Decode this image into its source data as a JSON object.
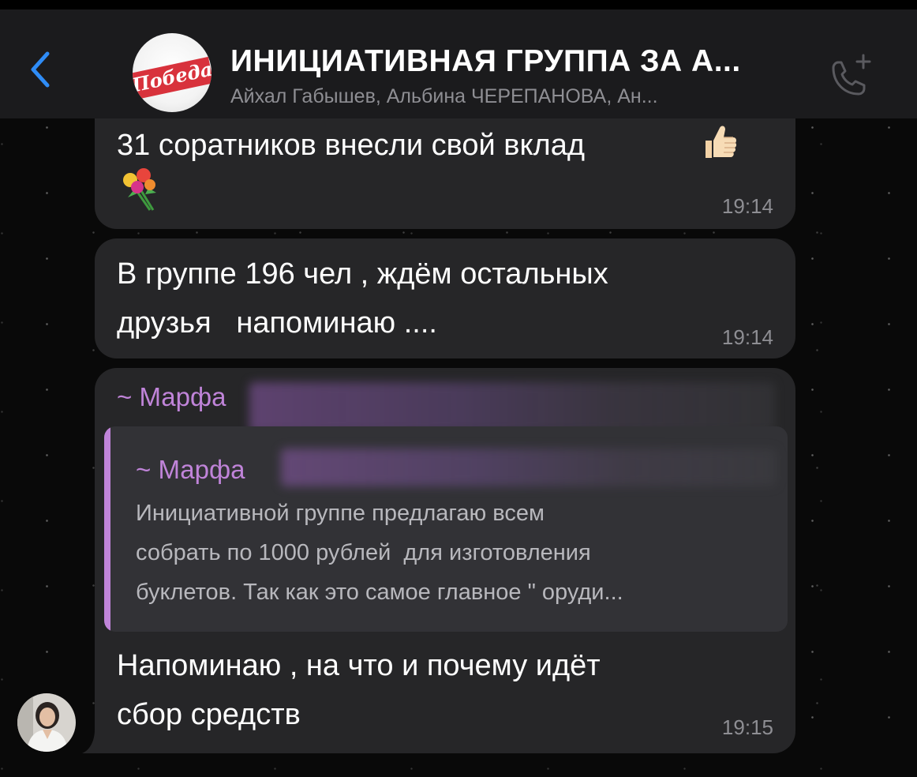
{
  "header": {
    "title": "ИНИЦИАТИВНАЯ ГРУППА ЗА А...",
    "subtitle": "Айхал Габышев, Альбина ЧЕРЕПАНОВА, Ан...",
    "avatar_text": "Победа",
    "back_icon": "chevron-left-icon",
    "call_icon": "add-call-icon",
    "accent_color": "#2f8cf6"
  },
  "messages": [
    {
      "text_lines": [
        "31 соратников внесли свой вклад"
      ],
      "emoji": [
        "thumbs-up-icon",
        "bouquet-icon"
      ],
      "time": "19:14"
    },
    {
      "text_lines": [
        "В группе 196 чел , ждём остальных",
        "друзья   напоминаю ...."
      ],
      "time": "19:14"
    },
    {
      "sender": "~ Марфа",
      "quote": {
        "sender": "~ Марфа",
        "lines": [
          "Инициативной группе предлагаю всем",
          "собрать по 1000 рублей  для изготовления",
          "буклетов. Так как это самое главное \" оруди..."
        ]
      },
      "text_lines": [
        "Напоминаю , на что и почему идёт",
        "сбор средств"
      ],
      "time": "19:15"
    }
  ],
  "colors": {
    "bubble": "#262628",
    "quote_bg": "#323236",
    "sender": "#c084d9",
    "time": "#8e8e93"
  }
}
